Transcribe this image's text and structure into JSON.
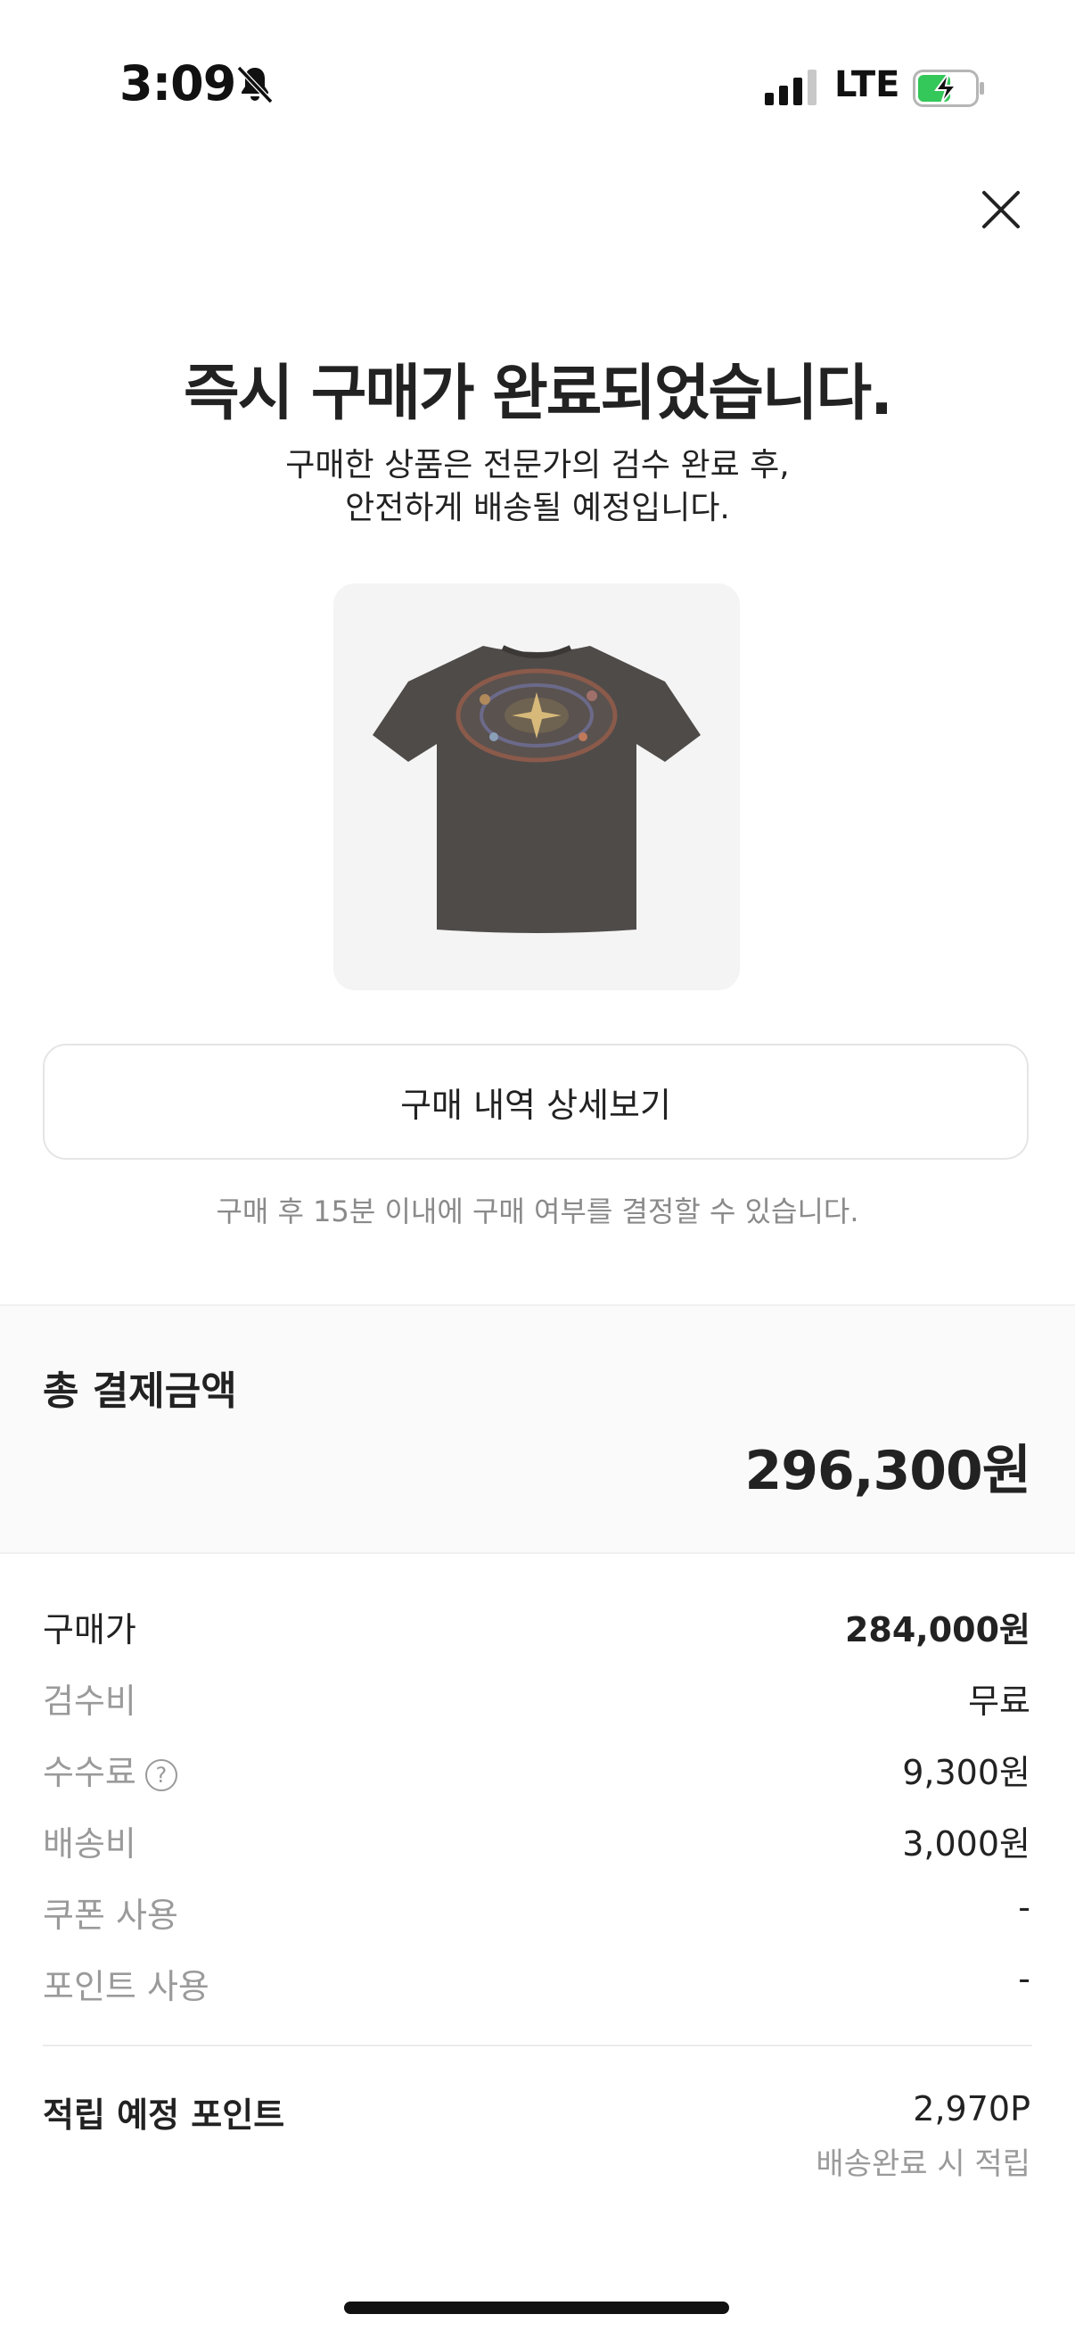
{
  "status_bar": {
    "time": "3:09",
    "network": "LTE"
  },
  "header": {
    "close_icon": "close-icon"
  },
  "main": {
    "title": "즉시 구매가 완료되었습니다.",
    "subtitle_line1": "구매한 상품은 전문가의 검수 완료 후,",
    "subtitle_line2": "안전하게 배송될 예정입니다.",
    "detail_button": "구매 내역 상세보기",
    "notice": "구매 후 15분 이내에 구매 여부를 결정할 수 있습니다."
  },
  "summary": {
    "total_label": "총 결제금액",
    "total_amount": "296,300원",
    "rows": [
      {
        "label": "구매가",
        "value": "284,000원"
      },
      {
        "label": "검수비",
        "value": "무료"
      },
      {
        "label": "수수료",
        "value": "9,300원"
      },
      {
        "label": "배송비",
        "value": "3,000원"
      },
      {
        "label": "쿠폰 사용",
        "value": "-"
      },
      {
        "label": "포인트 사용",
        "value": "-"
      }
    ],
    "fee_help": "?",
    "points_label": "적립 예정 포인트",
    "points_value": "2,970P",
    "points_note": "배송완료 시 적립"
  },
  "colors": {
    "accent_battery": "#34c759",
    "muted_text": "#9a9a9a",
    "panel_bg": "#fafafa"
  }
}
